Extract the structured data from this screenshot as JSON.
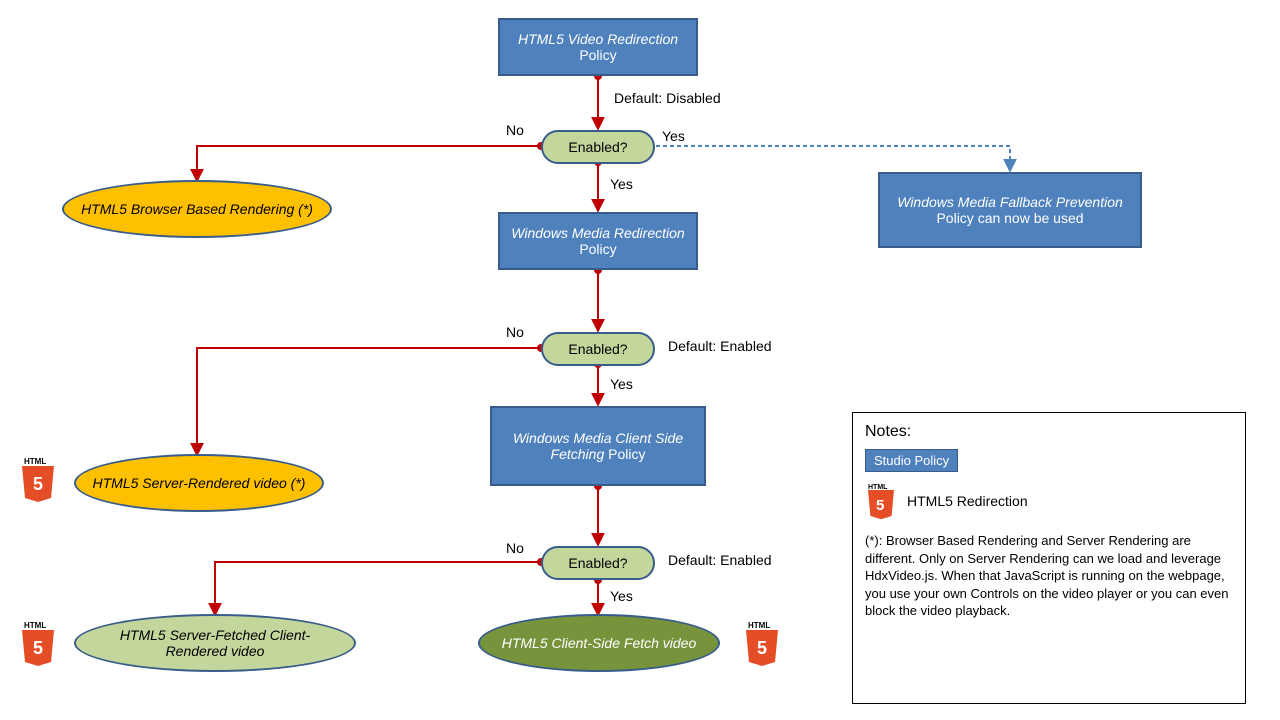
{
  "nodes": {
    "n1_a": "HTML5 Video Redirection",
    "n1_b": " Policy",
    "n2_a": "Windows Media Redirection",
    "n2_b": " Policy",
    "n3_a": "Windows Media Client Side Fetching",
    "n3_b": " Policy",
    "n4_a": "Windows Media Fallback Prevention",
    "n4_b": " Policy can now be used",
    "d1": "Enabled?",
    "d2": "Enabled?",
    "d3": "Enabled?",
    "o1": "HTML5 Browser Based Rendering (*)",
    "o2": "HTML5 Server-Rendered video (*)",
    "o3": "HTML5 Server-Fetched Client-Rendered video",
    "o4": "HTML5 Client-Side Fetch video"
  },
  "labels": {
    "default_disabled": "Default: Disabled",
    "default_enabled": "Default: Enabled",
    "yes": "Yes",
    "no": "No"
  },
  "notes": {
    "title": "Notes:",
    "policy": "Studio Policy",
    "redir": "HTML5 Redirection",
    "footnote": "(*): Browser Based Rendering and Server Rendering are different. Only on Server Rendering can we load and leverage HdxVideo.js. When that JavaScript is running on the webpage, you use your own Controls on the video player or you can even block the video playback."
  },
  "html5": "HTML"
}
